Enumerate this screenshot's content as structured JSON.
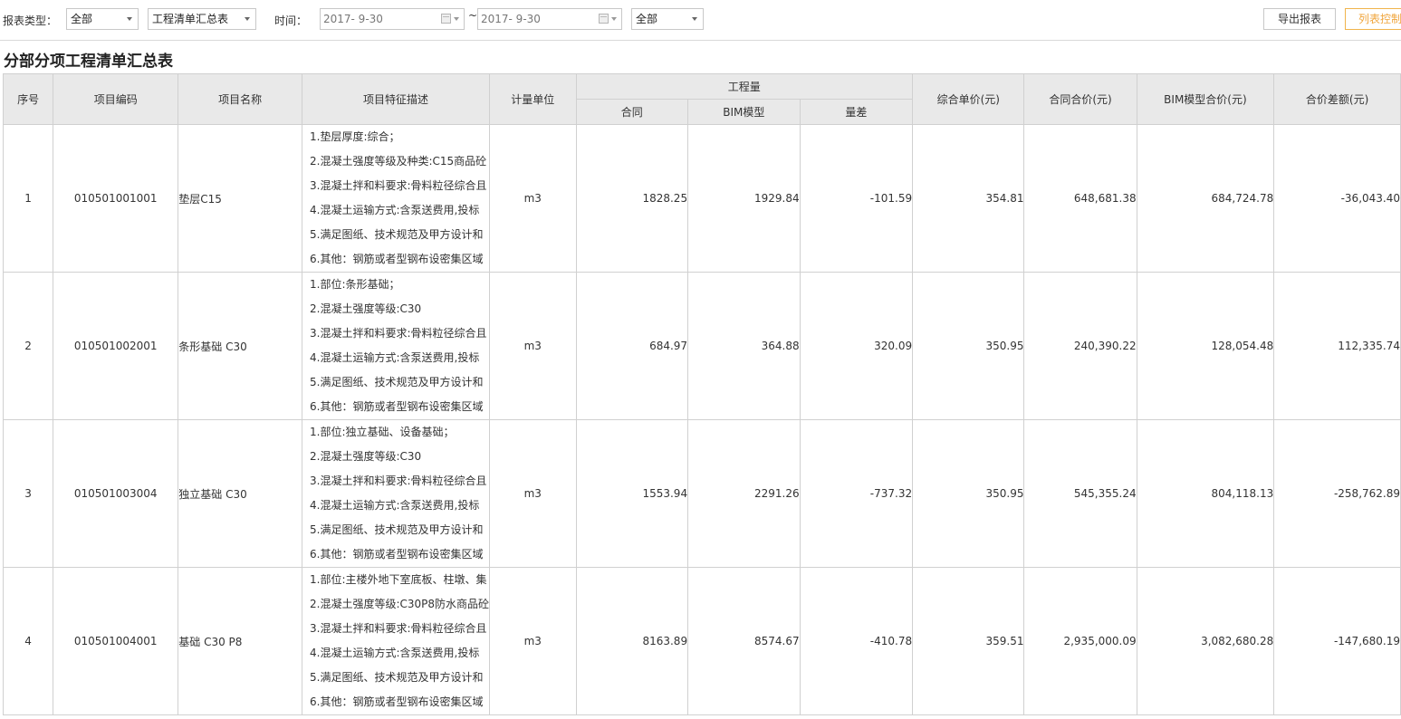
{
  "toolbar": {
    "report_type_label": "报表类型：",
    "report_type_value": "全部",
    "report_name_value": "工程清单汇总表",
    "time_label": "时间：",
    "date_from": "2017-  9-30",
    "tilde": "~",
    "date_to": "2017-  9-30",
    "scope_value": "全部",
    "export_label": "导出报表",
    "column_control_label": "列表控制"
  },
  "title": "分部分项工程清单汇总表",
  "table": {
    "headers": {
      "seq": "序号",
      "code": "项目编码",
      "name": "项目名称",
      "desc": "项目特征描述",
      "unit": "计量单位",
      "qty_group": "工程量",
      "qty_contract": "合同",
      "qty_bim": "BIM模型",
      "qty_diff": "量差",
      "unit_price": "综合单价(元)",
      "contract_total": "合同合价(元)",
      "bim_total": "BIM模型合价(元)",
      "total_diff": "合价差额(元)"
    },
    "rows": [
      {
        "seq": "1",
        "code": "010501001001",
        "name": "垫层C15",
        "desc": [
          "1.垫层厚度:综合；",
          "2.混凝土强度等级及种类:C15商品砼",
          "3.混凝土拌和料要求:骨料粒径综合且",
          "4.混凝土运输方式:含泵送费用,投标",
          "5.满足图纸、技术规范及甲方设计和",
          "6.其他：钢筋或者型钢布设密集区域"
        ],
        "unit": "m3",
        "qty_contract": "1828.25",
        "qty_bim": "1929.84",
        "qty_diff": "-101.59",
        "unit_price": "354.81",
        "contract_total": "648,681.38",
        "bim_total": "684,724.78",
        "total_diff": "-36,043.40",
        "diff_negative": true
      },
      {
        "seq": "2",
        "code": "010501002001",
        "name": "条形基础 C30",
        "desc": [
          "1.部位:条形基础；",
          "2.混凝土强度等级:C30",
          "3.混凝土拌和料要求:骨料粒径综合且",
          "4.混凝土运输方式:含泵送费用,投标",
          "5.满足图纸、技术规范及甲方设计和",
          "6.其他：钢筋或者型钢布设密集区域"
        ],
        "unit": "m3",
        "qty_contract": "684.97",
        "qty_bim": "364.88",
        "qty_diff": "320.09",
        "unit_price": "350.95",
        "contract_total": "240,390.22",
        "bim_total": "128,054.48",
        "total_diff": "112,335.74",
        "diff_negative": false
      },
      {
        "seq": "3",
        "code": "010501003004",
        "name": "独立基础 C30",
        "desc": [
          "1.部位:独立基础、设备基础；",
          "2.混凝土强度等级:C30",
          "3.混凝土拌和料要求:骨料粒径综合且",
          "4.混凝土运输方式:含泵送费用,投标",
          "5.满足图纸、技术规范及甲方设计和",
          "6.其他：钢筋或者型钢布设密集区域"
        ],
        "unit": "m3",
        "qty_contract": "1553.94",
        "qty_bim": "2291.26",
        "qty_diff": "-737.32",
        "unit_price": "350.95",
        "contract_total": "545,355.24",
        "bim_total": "804,118.13",
        "total_diff": "-258,762.89",
        "diff_negative": true
      },
      {
        "seq": "4",
        "code": "010501004001",
        "name": "基础 C30 P8",
        "desc": [
          "1.部位:主楼外地下室底板、柱墩、集",
          "2.混凝土强度等级:C30P8防水商品砼",
          "3.混凝土拌和料要求:骨料粒径综合且",
          "4.混凝土运输方式:含泵送费用,投标",
          "5.满足图纸、技术规范及甲方设计和",
          "6.其他：钢筋或者型钢布设密集区域"
        ],
        "unit": "m3",
        "qty_contract": "8163.89",
        "qty_bim": "8574.67",
        "qty_diff": "-410.78",
        "unit_price": "359.51",
        "contract_total": "2,935,000.09",
        "bim_total": "3,082,680.28",
        "total_diff": "-147,680.19",
        "diff_negative": true
      }
    ]
  },
  "colors": {
    "negative": "#e02020",
    "header_bg": "#e9e9e9",
    "accent_orange": "#f0a53c"
  }
}
